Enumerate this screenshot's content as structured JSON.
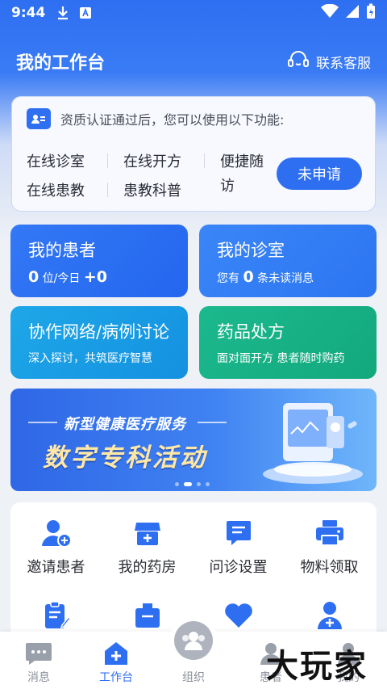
{
  "status_bar": {
    "time": "9:44"
  },
  "header": {
    "title": "我的工作台",
    "contact_label": "联系客服"
  },
  "notice": {
    "text": "资质认证通过后，您可以使用以下功能:",
    "features": [
      "在线诊室",
      "在线开方",
      "便捷随",
      "访",
      "在线患教",
      "患教科普"
    ],
    "apply_label": "未申请",
    "colors": {
      "accent": "#2e6ff2"
    }
  },
  "cards": [
    {
      "title": "我的患者",
      "patients_count": "0",
      "patients_unit": "位/今日",
      "today_new": "+0"
    },
    {
      "title": "我的诊室",
      "prefix": "您有",
      "count": "0",
      "suffix": "条未读消息"
    },
    {
      "title": "协作网络/病例讨论",
      "subtitle": "深入探讨，共筑医疗智慧"
    },
    {
      "title": "药品处方",
      "subtitle": "面对面开方 患者随时购药"
    }
  ],
  "banner": {
    "subtitle": "新型健康医疗服务",
    "title": "数字专科活动",
    "active_slide": 2,
    "slide_count": 4
  },
  "tools": [
    {
      "label": "邀请患者",
      "icon": "add-user-icon"
    },
    {
      "label": "我的药房",
      "icon": "pharmacy-store-icon"
    },
    {
      "label": "问诊设置",
      "icon": "consult-settings-icon"
    },
    {
      "label": "物料领取",
      "icon": "printer-icon"
    },
    {
      "label": "",
      "icon": "clipboard-edit-icon"
    },
    {
      "label": "",
      "icon": "box-icon"
    },
    {
      "label": "",
      "icon": "heart-icon"
    },
    {
      "label": "",
      "icon": "doctor-icon"
    }
  ],
  "tabbar": {
    "tabs": [
      {
        "label": "消息",
        "icon": "message-icon"
      },
      {
        "label": "工作台",
        "icon": "workbench-icon",
        "active": true
      },
      {
        "label": "组织",
        "icon": "organization-icon"
      },
      {
        "label": "患者",
        "icon": "patient-icon"
      },
      {
        "label": "我的",
        "icon": "profile-icon"
      }
    ]
  },
  "watermark": "大玩家"
}
